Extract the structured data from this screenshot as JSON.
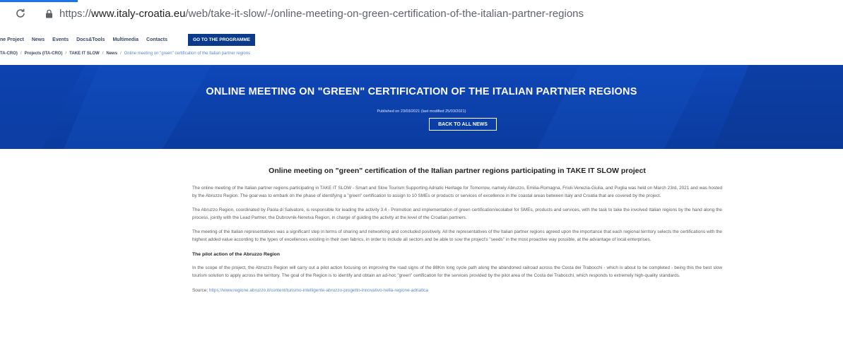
{
  "browser": {
    "url_prefix": "https://",
    "url_host": "www.italy-croatia.eu",
    "url_path": "/web/take-it-slow/-/online-meeting-on-green-certification-of-the-italian-partner-regions"
  },
  "nav": {
    "items": [
      "ne Project",
      "News",
      "Events",
      "Docs&Tools",
      "Multimedia",
      "Contacts"
    ],
    "cta": "GO TO THE PROGRAMME"
  },
  "breadcrumb": {
    "items": [
      "TA-CRO)",
      "Projects (ITA-CRO)",
      "TAKE IT SLOW",
      "News"
    ],
    "current": "Online meeting on \"green\" certification of the Italian partner regions"
  },
  "banner": {
    "title": "ONLINE MEETING ON \"GREEN\" CERTIFICATION OF THE ITALIAN PARTNER REGIONS",
    "published": "Published on 23/03/2021 (last modified 25/03/2021)",
    "back_label": "BACK TO ALL NEWS",
    "color": "#0c3fa6"
  },
  "article": {
    "heading": "Online meeting on \"green\" certification of the Italian partner regions participating in TAKE IT SLOW project",
    "p1": "The online meeting of the Italian partner regions participating in TAKE IT SLOW - Smart and Slow Tourism Supporting Adriatic Heritage for Tomorrow, namely Abruzzo, Emilia-Romagna, Friuli-Venezia-Giulia, and Puglia was held on March 23rd, 2021 and was hosted by the Abruzzo Region. The goal was to embark on the phase of identifying a \"green\" certification to assign to 10 SMEs or products or services of excellence in the coastal areas between Italy and Croatia that are covered by the project.",
    "p2": "The Abruzzo Region, coordinated by Paola di Salvatore, is responsible for leading the activity 3.4 - Promotion and implementation of green certification/ecolabel for SMEs, products and services, with the task to take the involved Italian regions by the hand along the process, jointly with the Lead Partner, the Dubrovnik-Neretva Region, in charge of guiding the activity at the level of the Croatian partners.",
    "p3": "The meeting of the Italian representatives was a significant step in terms of sharing and networking and concluded positively. All the representatives of the Italian partner regions agreed upon the importance that each regional territory selects the certifications with the highest added value according to the types of excellences existing in their own fabrics, in order to include all sectors and be able to sow the project's \"seeds\" in the most proactive way possible, at the advantage of local enterprises.",
    "subheading": "The pilot action of the Abruzzo Region",
    "p4": "In the scope of the project, the Abruzzo Region will carry out a pilot action focusing on improving the road signs of the 88Km long cycle path along the abandoned railroad across the Costa dei Trabocchi - which is about to be completed - being this the best slow tourism solution to apply across the territory. The goal of the Region is to identify and obtain an ad-hoc \"green\" certification for the services provided by the pilot area of the Costa dei Trabocchi, which responds to extremely high-quality standards.",
    "source_label": "Source:",
    "source_url": "https://www.regione.abruzzo.it/content/turismo-intelligente-abruzzo-progetto-innovativo-nella-regione-adriatica"
  }
}
